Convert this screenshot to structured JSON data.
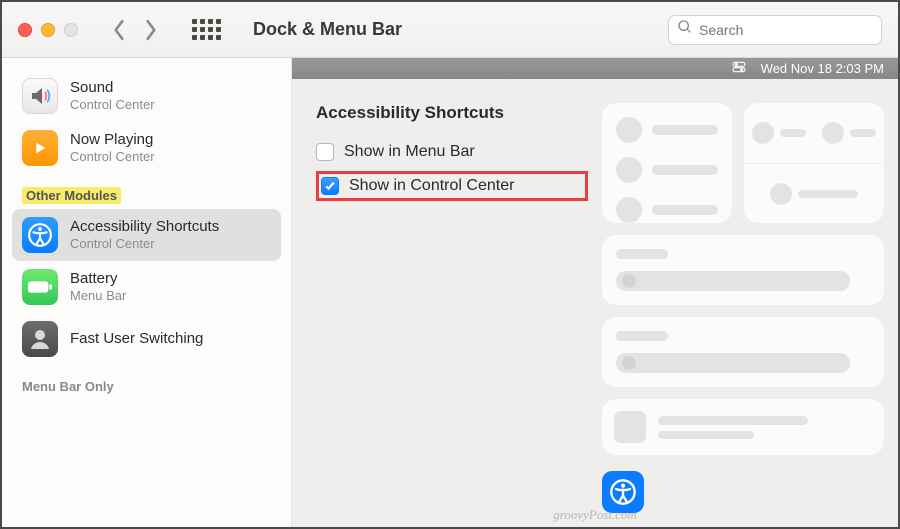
{
  "toolbar": {
    "title": "Dock & Menu Bar",
    "search_placeholder": "Search"
  },
  "sidebar": {
    "group_top": [
      {
        "title": "Sound",
        "sub": "Control Center"
      },
      {
        "title": "Now Playing",
        "sub": "Control Center"
      }
    ],
    "header_other": "Other Modules",
    "group_other": [
      {
        "title": "Accessibility Shortcuts",
        "sub": "Control Center"
      },
      {
        "title": "Battery",
        "sub": "Menu Bar"
      },
      {
        "title": "Fast User Switching",
        "sub": ""
      }
    ],
    "header_menubar": "Menu Bar Only"
  },
  "menubar_preview": {
    "datetime": "Wed Nov 18  2:03 PM"
  },
  "settings": {
    "heading": "Accessibility Shortcuts",
    "opt_menu_bar": "Show in Menu Bar",
    "opt_control_center": "Show in Control Center",
    "checked_menu_bar": false,
    "checked_control_center": true
  },
  "watermark": "groovyPost.com"
}
